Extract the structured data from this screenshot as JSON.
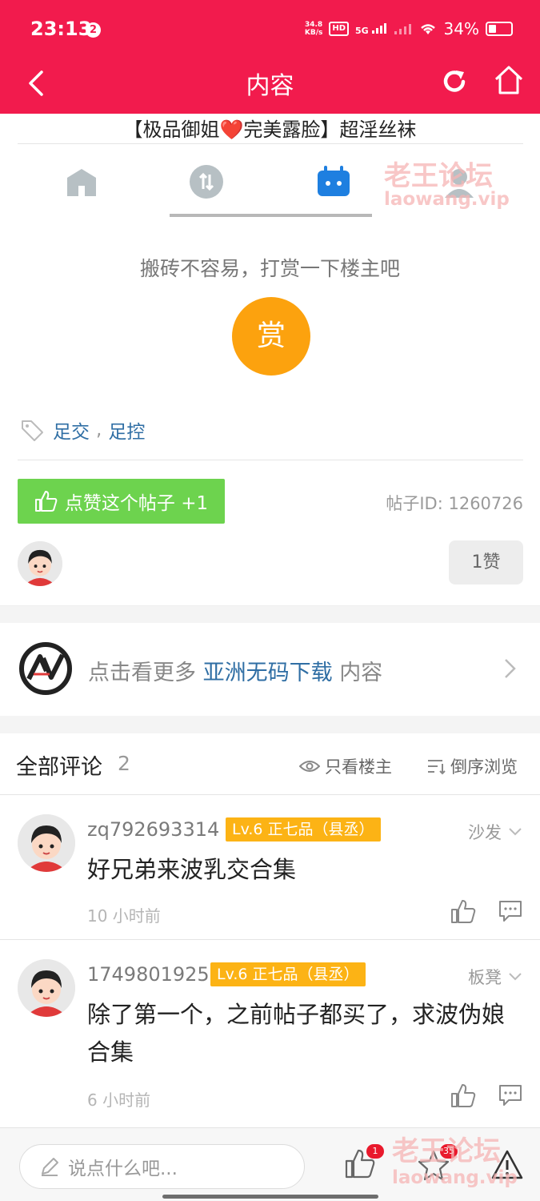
{
  "status_bar": {
    "time": "23:13",
    "notification_count": "2",
    "net_speed_value": "34.8",
    "net_speed_unit": "KB/s",
    "hd_label": "HD",
    "network_label": "5G",
    "battery": "34%",
    "battery_level": 0.34
  },
  "nav": {
    "title": "内容",
    "back_icon": "chevron-left-icon",
    "refresh_icon": "refresh-icon",
    "home_icon": "home-icon"
  },
  "post": {
    "title": "【极品御姐❤️完美露脸】超淫丝袜",
    "reward_prompt": "搬砖不容易，打赏一下楼主吧",
    "reward_button": "赏",
    "tags": [
      "足交",
      "足控"
    ],
    "tag_separator": ",",
    "like_button": "点赞这个帖子 +1",
    "post_id": "帖子ID: 1260726",
    "likes": "1赞"
  },
  "watermark": {
    "brand": "老王论坛",
    "domain": "laowang.vip"
  },
  "promo": {
    "prefix": "点击看更多",
    "highlight": "亚洲无码下载",
    "suffix": "内容"
  },
  "comments_header": {
    "label": "全部评论",
    "count": "2",
    "only_op": "只看楼主",
    "reverse": "倒序浏览"
  },
  "comments": [
    {
      "user": "zq792693314",
      "level": "Lv.6 正七品（县丞）",
      "floor": "沙发",
      "body": "好兄弟来波乳交合集",
      "time": "10 小时前"
    },
    {
      "user": "1749801925",
      "level": "Lv.6 正七品（县丞）",
      "floor": "板凳",
      "body": "除了第一个，之前帖子都买了，求波伪娘合集",
      "time": "6 小时前"
    }
  ],
  "bottom_bar": {
    "input_placeholder": "说点什么吧...",
    "like_badge": "1",
    "favorite_badge": "35"
  },
  "colors": {
    "brand_red": "#f21b4d",
    "reward_orange": "#fca20e",
    "like_green": "#6dd34e",
    "level_badge": "#fcb315",
    "link_blue": "#2f6ea4"
  }
}
